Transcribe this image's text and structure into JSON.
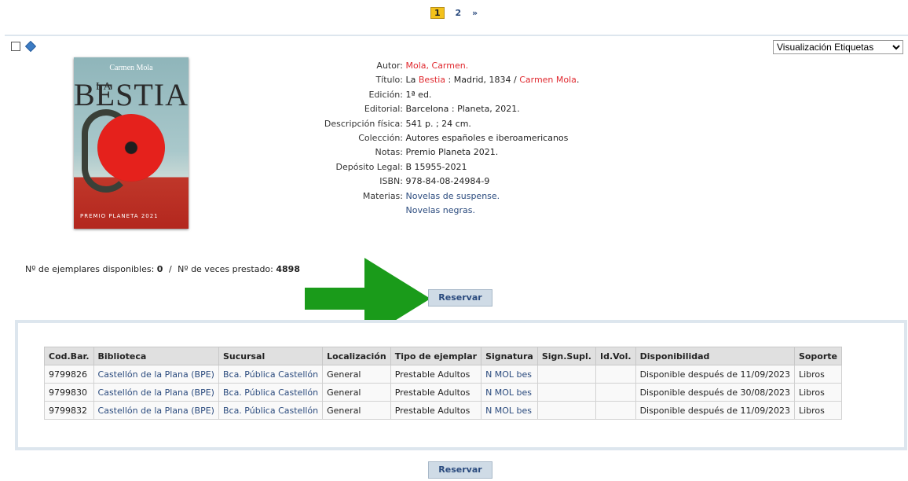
{
  "pagination": {
    "current": "1",
    "next": "2",
    "next_arrow": "»"
  },
  "view_select": {
    "selected": "Visualización Etiquetas"
  },
  "cover": {
    "author": "Carmen Mola",
    "title": "BESTIA",
    "title_prefix": "LA",
    "badge": "PREMIO PLANETA 2021"
  },
  "record": {
    "autor": {
      "label": "Autor:",
      "value": "Mola, Carmen."
    },
    "titulo": {
      "label": "Título:",
      "prefix": "La ",
      "link": "Bestia",
      "middle": " : Madrid, 1834 / ",
      "author_link": "Carmen Mola",
      "suffix": "."
    },
    "edicion": {
      "label": "Edición:",
      "value": "1ª ed."
    },
    "editorial": {
      "label": "Editorial:",
      "value": "Barcelona : Planeta, 2021."
    },
    "descripcion": {
      "label": "Descripción física:",
      "value": "541 p. ; 24 cm."
    },
    "coleccion": {
      "label": "Colección:",
      "value": "Autores españoles e iberoamericanos"
    },
    "notas": {
      "label": "Notas:",
      "value": "Premio Planeta 2021."
    },
    "deposito": {
      "label": "Depósito Legal:",
      "value": "B 15955-2021"
    },
    "isbn": {
      "label": "ISBN:",
      "value": "978-84-08-24984-9"
    },
    "materias": {
      "label": "Materias:",
      "values": [
        "Novelas de suspense.",
        "Novelas negras."
      ]
    }
  },
  "stats": {
    "available_label": "Nº de ejemplares disponibles:",
    "available": "0",
    "separator": "/",
    "loans_label": "Nº de veces prestado:",
    "loans": "4898"
  },
  "buttons": {
    "reserve": "Reservar"
  },
  "table": {
    "headers": [
      "Cod.Bar.",
      "Biblioteca",
      "Sucursal",
      "Localización",
      "Tipo de ejemplar",
      "Signatura",
      "Sign.Supl.",
      "Id.Vol.",
      "Disponibilidad",
      "Soporte"
    ],
    "rows": [
      [
        "9799826",
        "Castellón de la Plana (BPE)",
        "Bca. Pública Castellón",
        "General",
        "Prestable Adultos",
        "N MOL bes",
        "",
        "",
        "Disponible después de 11/09/2023",
        "Libros"
      ],
      [
        "9799830",
        "Castellón de la Plana (BPE)",
        "Bca. Pública Castellón",
        "General",
        "Prestable Adultos",
        "N MOL bes",
        "",
        "",
        "Disponible después de 30/08/2023",
        "Libros"
      ],
      [
        "9799832",
        "Castellón de la Plana (BPE)",
        "Bca. Pública Castellón",
        "General",
        "Prestable Adultos",
        "N MOL bes",
        "",
        "",
        "Disponible después de 11/09/2023",
        "Libros"
      ]
    ]
  },
  "colors": {
    "link_red": "#e0282e",
    "link_blue": "#2b4b7e",
    "arrow_green": "#1a9b1a",
    "pager_current": "#f4c21b"
  }
}
